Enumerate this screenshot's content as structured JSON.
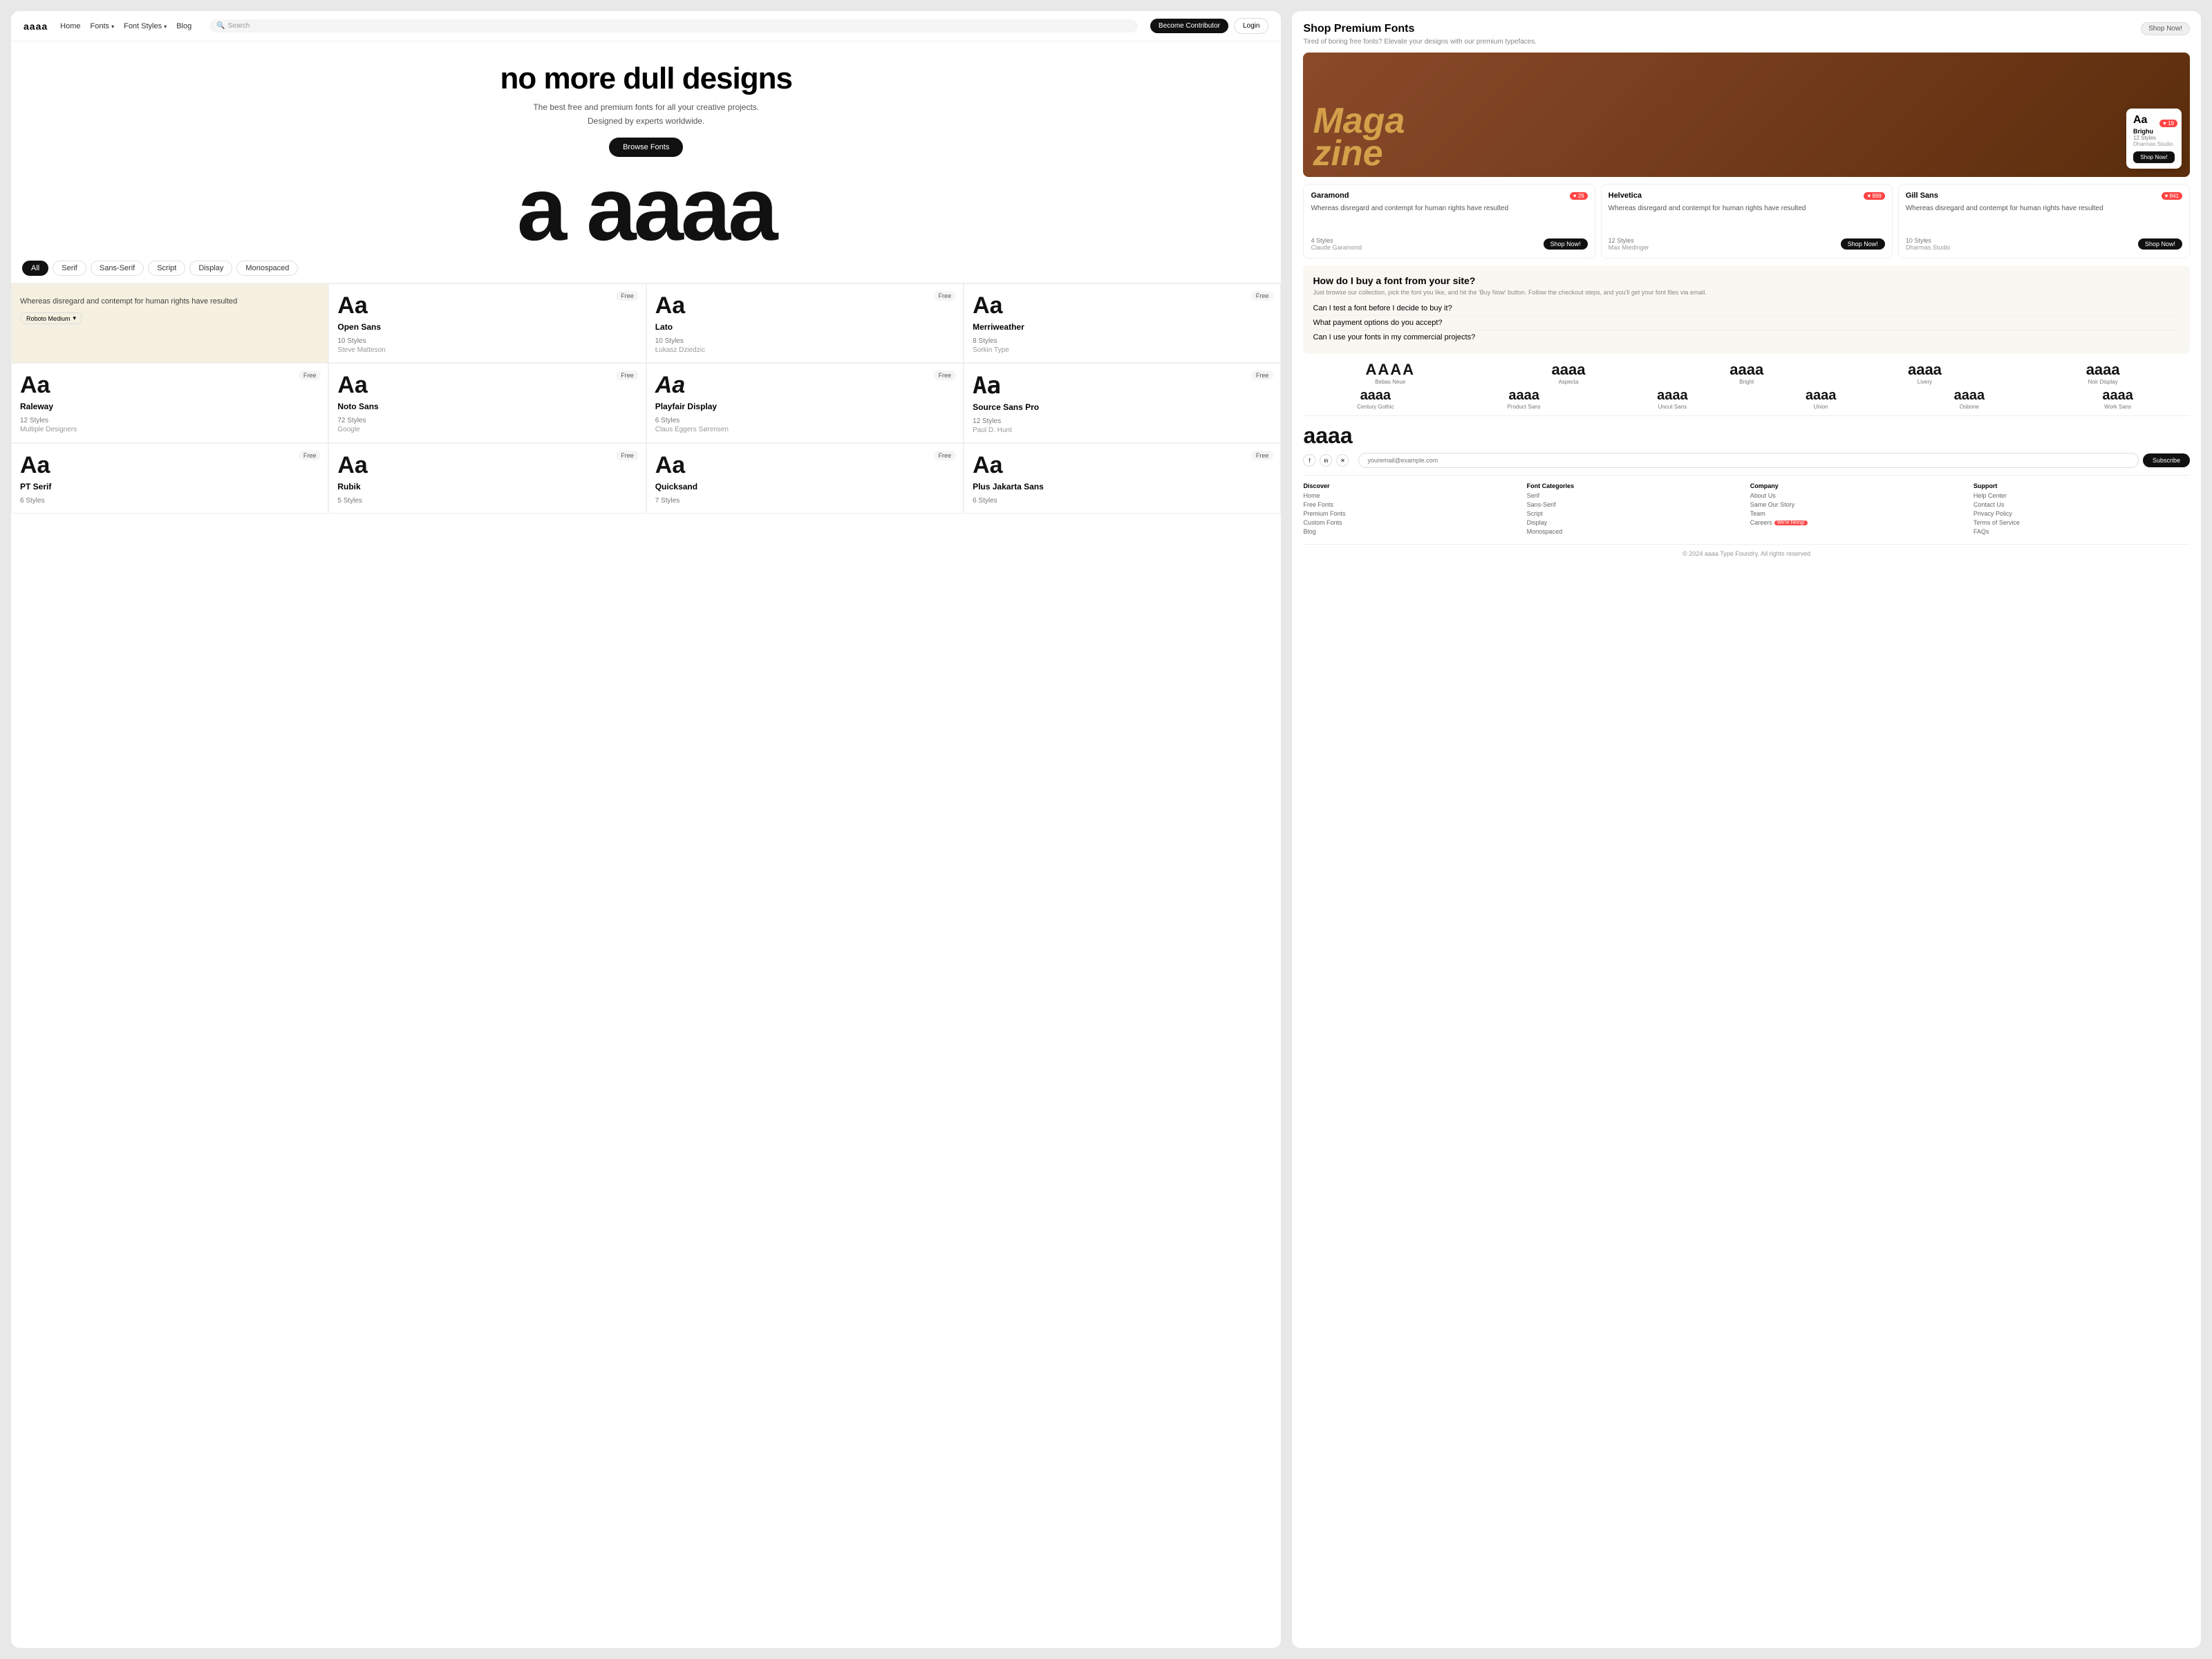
{
  "site": {
    "logo": "aaaa",
    "nav": {
      "home": "Home",
      "fonts": "Fonts",
      "font_styles": "Font Styles",
      "blog": "Blog",
      "search_placeholder": "Search",
      "contribute_label": "Become Contributor",
      "login_label": "Login"
    }
  },
  "hero": {
    "title": "no more dull designs",
    "subtitle_line1": "The best free and premium fonts for all your creative projects.",
    "subtitle_line2": "Designed by experts worldwide.",
    "browse_button": "Browse Fonts",
    "big_text": "a aaaa"
  },
  "filters": {
    "tabs": [
      "All",
      "Serif",
      "Sans-Serif",
      "Script",
      "Display",
      "Monospaced"
    ]
  },
  "font_cards": [
    {
      "id": "featured",
      "featured": true,
      "preview_text": "Whereas disregard and contempt for human rights have resulted",
      "name": "Roboto Medium",
      "type": "dropdown"
    },
    {
      "id": "open-sans",
      "badge": "Free",
      "aa": "Aa",
      "name": "Open Sans",
      "styles": "10 Styles",
      "author": "Steve Matteson"
    },
    {
      "id": "lato",
      "badge": "Free",
      "aa": "Aa",
      "name": "Lato",
      "styles": "10 Styles",
      "author": "Łukasz Dziedzic"
    },
    {
      "id": "merriweather",
      "badge": "Free",
      "aa": "Aa",
      "name": "Merriweather",
      "styles": "8 Styles",
      "author": "Sorkin Type"
    },
    {
      "id": "raleway",
      "badge": "Free",
      "aa": "Aa",
      "name": "Raleway",
      "styles": "12 Styles",
      "author": "Multiple Designers"
    },
    {
      "id": "noto-sans",
      "badge": "Free",
      "aa": "Aa",
      "name": "Noto Sans",
      "styles": "72 Styles",
      "author": "Google"
    },
    {
      "id": "playfair",
      "badge": "Free",
      "aa": "Aa",
      "name": "Playfair Display",
      "styles": "6 Styles",
      "author": "Claus Eggers Sørensen",
      "serif": true
    },
    {
      "id": "source-sans",
      "badge": "Free",
      "aa": "Aa",
      "name": "Source Sans Pro",
      "styles": "12 Styles",
      "author": "Paul D. Hunt",
      "mono": true
    },
    {
      "id": "pt-serif",
      "badge": "Free",
      "aa": "Aa",
      "name": "PT Serif",
      "styles": "6 Styles",
      "author": ""
    },
    {
      "id": "rubik",
      "badge": "Free",
      "aa": "Aa",
      "name": "Rubik",
      "styles": "5 Styles",
      "author": ""
    },
    {
      "id": "quicksand",
      "badge": "Free",
      "aa": "Aa",
      "name": "Quicksand",
      "styles": "7 Styles",
      "author": ""
    },
    {
      "id": "plus-jakarta",
      "badge": "Free",
      "aa": "Aa",
      "name": "Plus Jakarta Sans",
      "styles": "6 Styles",
      "author": ""
    }
  ],
  "right_panel": {
    "shop_title": "Shop Premium Fonts",
    "shop_subtitle": "Tired of boring free fonts? Elevate your designs with our premium typefaces.",
    "shop_now": "Shop Now!",
    "magazine_text": "Maga zine",
    "magazine_card": {
      "aa": "Aa",
      "name": "Brighu",
      "styles": "12 Styles",
      "studio": "Dharmas Studio",
      "shop_btn": "Shop Now!"
    },
    "font_row_cards": [
      {
        "name": "Garamond",
        "likes": "29",
        "preview": "Whereas disregard and contempt for human rights have resulted",
        "styles": "4 Styles",
        "author": "Claude Garamond",
        "shop_btn": "Shop Now!"
      },
      {
        "name": "Helvetica",
        "likes": "899",
        "preview": "Whereas disregard and contempt for human rights have resulted",
        "styles": "12 Styles",
        "author": "Max Miedinger",
        "shop_btn": "Shop Now!"
      },
      {
        "name": "Gill Sans",
        "likes": "841",
        "preview": "Whereas disregard and contempt for human rights have resulted",
        "styles": "10 Styles",
        "author": "Dharmas Studio",
        "shop_btn": "Shop Now!"
      }
    ],
    "faq": {
      "title": "How do I buy a font from your site?",
      "subtitle": "Just browse our collection, pick the font you like, and hit the 'Buy Now' button. Follow the checkout steps, and you'll get your font files via email.",
      "items": [
        "Can I test a font before I decide to buy it?",
        "What payment options do you accept?",
        "Can I use your fonts in my commercial projects?"
      ]
    },
    "showcase_row1": [
      {
        "aa": "AAAA",
        "name": "Bebas Neue"
      },
      {
        "aa": "aaaa",
        "name": "Aspecta"
      },
      {
        "aa": "aaaa",
        "name": "Bright"
      },
      {
        "aa": "aaaa",
        "name": "Livery"
      },
      {
        "aa": "aaaa",
        "name": "Noir Display"
      }
    ],
    "showcase_row2": [
      {
        "aa": "aaaa",
        "name": "Century Gothic"
      },
      {
        "aa": "aaaa",
        "name": "Product Sans"
      },
      {
        "aa": "aaaa",
        "name": "Uncut Sans"
      },
      {
        "aa": "aaaa",
        "name": "Union"
      },
      {
        "aa": "aaaa",
        "name": "Osbone"
      },
      {
        "aa": "aaaa",
        "name": "Work Sans"
      }
    ],
    "newsletter": {
      "big_text": "aaaa",
      "email_placeholder": "youremail@example.com",
      "subscribe_btn": "Subscribe"
    },
    "footer": {
      "cols": [
        {
          "title": "Discover",
          "links": [
            "Home",
            "Free Fonts",
            "Premium Fonts",
            "Custom Fonts",
            "Blog"
          ]
        },
        {
          "title": "Font Categories",
          "links": [
            "Serif",
            "Sans-Serif",
            "Script",
            "Display",
            "Monospaced"
          ]
        },
        {
          "title": "Company",
          "links": [
            "About Us",
            "Same Our Story",
            "Team",
            "Careers",
            "We're Hiring!"
          ]
        },
        {
          "title": "Support",
          "links": [
            "Help Center",
            "Contact Us",
            "Privacy Policy",
            "Terms of Service",
            "FAQs"
          ]
        }
      ],
      "copyright": "© 2024 aaaa Type Foundry. All rights reserved"
    }
  }
}
